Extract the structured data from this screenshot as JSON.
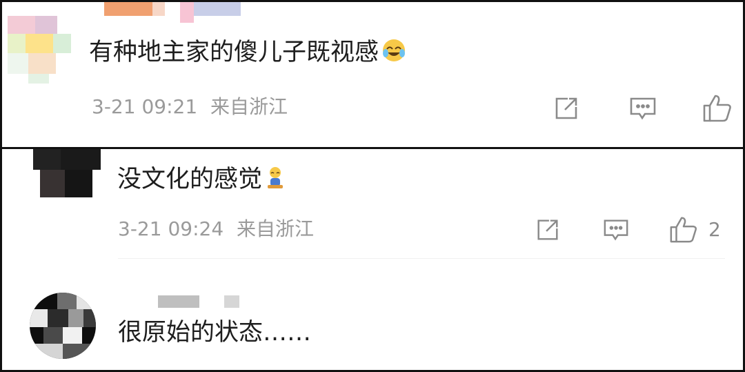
{
  "comments": [
    {
      "text": "有种地主家的傻儿子既视感",
      "emoji": "laughing-crying-emoji",
      "time": "3-21 09:21",
      "location": "来自浙江",
      "like_count": ""
    },
    {
      "text": "没文化的感觉",
      "emoji": "sitting-figure-emoji",
      "time": "3-21 09:24",
      "location": "来自浙江",
      "like_count": "2"
    },
    {
      "text": "很原始的状态……"
    }
  ],
  "icons": {
    "share": "share-icon",
    "comment": "comment-icon",
    "like": "thumbs-up-icon"
  },
  "colors": {
    "text": "#1e1e1e",
    "meta": "#9a9a9a",
    "icon": "#8a8a8a"
  }
}
